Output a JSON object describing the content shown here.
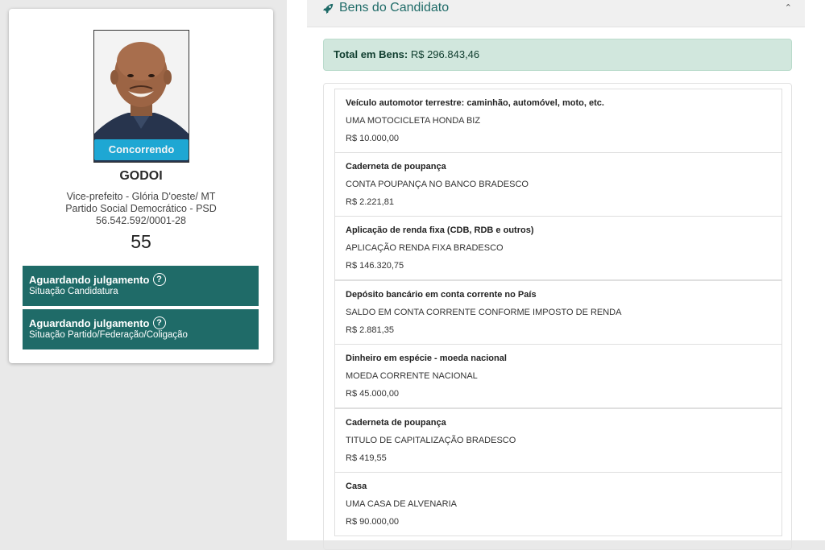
{
  "candidate": {
    "status_label": "Concorrendo",
    "name": "GODOI",
    "office_line": "Vice-prefeito - Glória D'oeste/ MT",
    "party_line": "Partido Social Democrático - PSD",
    "cnpj": "56.542.592/0001-28",
    "number": "55"
  },
  "situations": [
    {
      "title": "Aguardando julgamento",
      "subtitle": "Situação Candidatura",
      "icon": "help-circle-icon"
    },
    {
      "title": "Aguardando julgamento",
      "subtitle": "Situação Partido/Federação/Coligação",
      "icon": "help-circle-icon"
    }
  ],
  "bens": {
    "header_title": "Bens do Candidato",
    "header_icon": "rocket-icon",
    "total_label": "Total em Bens:",
    "total_value": "R$ 296.843,46",
    "items": [
      {
        "type": "Veículo automotor terrestre: caminhão, automóvel, moto, etc.",
        "description": "UMA MOTOCICLETA HONDA BIZ",
        "value": "R$ 10.000,00"
      },
      {
        "type": "Caderneta de poupança",
        "description": "CONTA POUPANÇA NO BANCO BRADESCO",
        "value": "R$ 2.221,81"
      },
      {
        "type": "Aplicação de renda fixa (CDB, RDB e outros)",
        "description": "APLICAÇÃO RENDA FIXA BRADESCO",
        "value": "R$ 146.320,75"
      },
      {
        "type": "Depósito bancário em conta corrente no País",
        "description": "SALDO EM CONTA CORRENTE CONFORME IMPOSTO DE RENDA",
        "value": "R$ 2.881,35"
      },
      {
        "type": "Dinheiro em espécie - moeda nacional",
        "description": "MOEDA CORRENTE NACIONAL",
        "value": "R$ 45.000,00"
      },
      {
        "type": "Caderneta de poupança",
        "description": "TITULO DE CAPITALIZAÇÃO BRADESCO",
        "value": "R$ 419,55"
      },
      {
        "type": "Casa",
        "description": "UMA CASA DE ALVENARIA",
        "value": "R$ 90.000,00"
      }
    ]
  },
  "colors": {
    "accent_teal": "#1f6b68",
    "status_blue": "#1eaedb",
    "success_bg": "#d1e7dd"
  }
}
